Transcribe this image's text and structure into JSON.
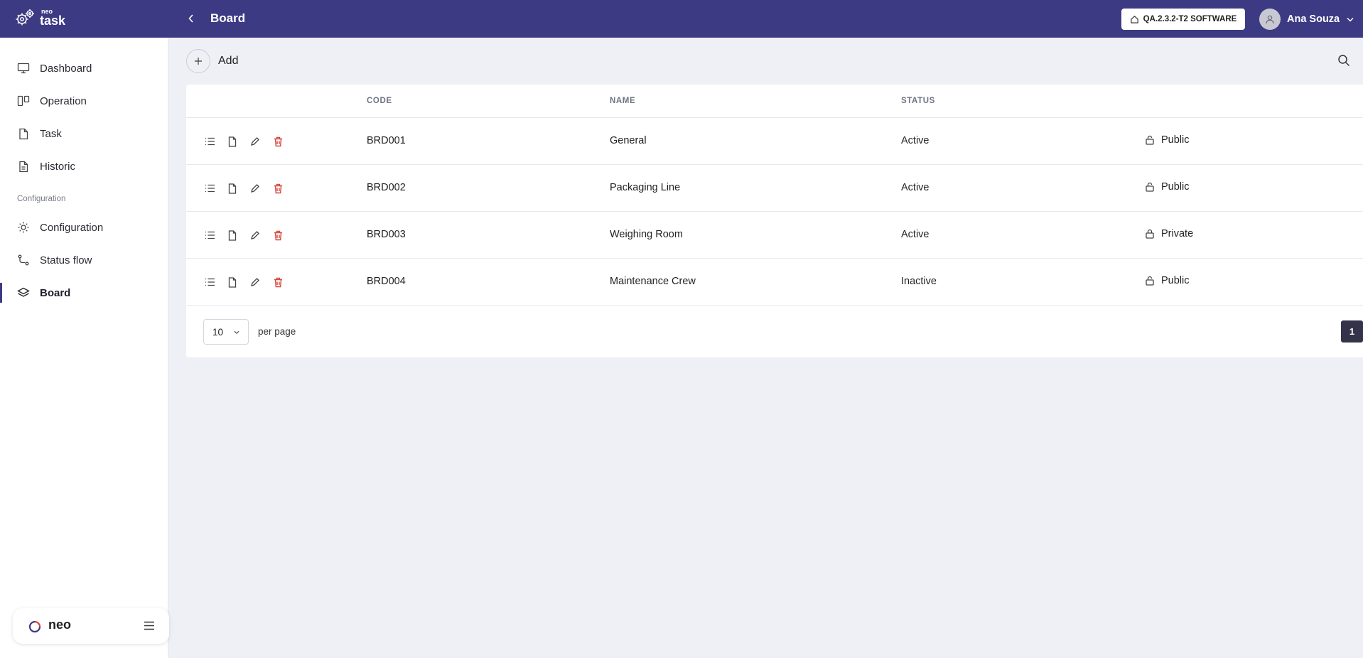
{
  "app": {
    "brand_small": "neo",
    "brand_name": "task",
    "page_title": "Board",
    "company_label": "QA.2.3.2-T2 SOFTWARE",
    "user_name": "Ana Souza"
  },
  "sidebar": {
    "items": [
      {
        "label": "Dashboard",
        "icon": "monitor-icon"
      },
      {
        "label": "Operation",
        "icon": "columns-icon"
      },
      {
        "label": "Task",
        "icon": "file-icon"
      },
      {
        "label": "Historic",
        "icon": "file-text-icon"
      }
    ],
    "section_label": "Configuration",
    "config_items": [
      {
        "label": "Configuration",
        "icon": "sun-icon"
      },
      {
        "label": "Status flow",
        "icon": "route-icon"
      },
      {
        "label": "Board",
        "icon": "layers-icon",
        "active": true
      }
    ],
    "footer_brand": "neo"
  },
  "toolbar": {
    "add_label": "Add"
  },
  "table": {
    "columns": [
      "CODE",
      "NAME",
      "STATUS"
    ],
    "rows": [
      {
        "code": "BRD001",
        "name": "General",
        "status": "Active",
        "visibility": "Public"
      },
      {
        "code": "BRD002",
        "name": "Packaging Line",
        "status": "Active",
        "visibility": "Public"
      },
      {
        "code": "BRD003",
        "name": "Weighing Room",
        "status": "Active",
        "visibility": "Private"
      },
      {
        "code": "BRD004",
        "name": "Maintenance Crew",
        "status": "Inactive",
        "visibility": "Public"
      }
    ]
  },
  "pagination": {
    "per_page_value": "10",
    "per_page_label": "per page",
    "current_page": "1"
  },
  "colors": {
    "topbar": "#3d3a84",
    "delete": "#d9453a",
    "page_active": "#33334a"
  }
}
